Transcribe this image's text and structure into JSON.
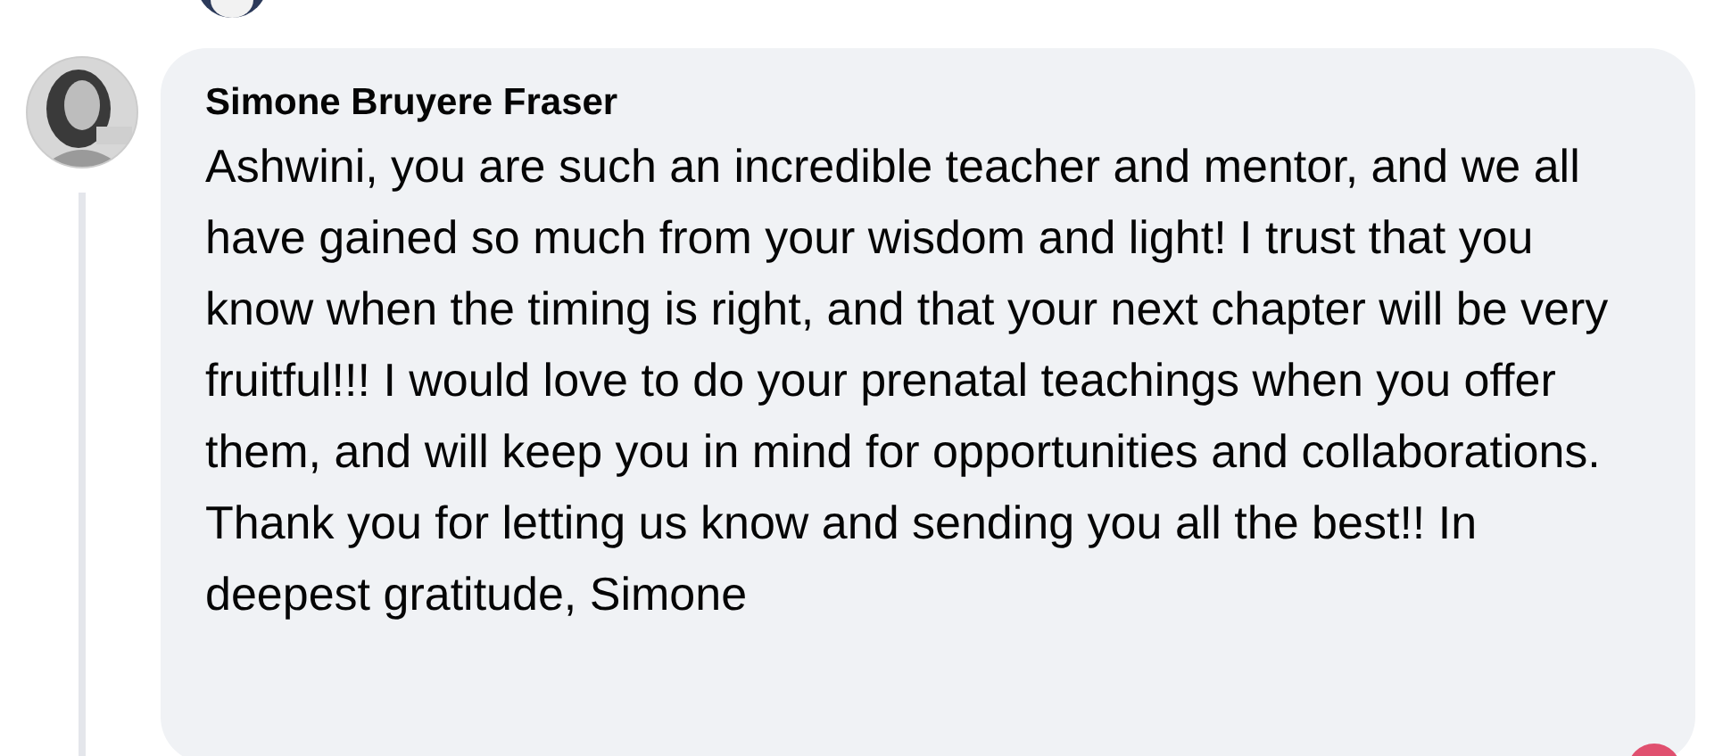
{
  "comment": {
    "author": "Simone Bruyere Fraser",
    "text": "Ashwini, you are such an incredible teacher and mentor, and we all have gained so much from your wisdom and light! I trust that you know when the timing is right, and that your next chapter will be very fruitful!!! I would love to do your prenatal teachings when you offer them, and will keep you in mind for opportunities and collaborations. Thank you for letting us know and sending you all the best!! In deepest gratitude, Simone"
  }
}
